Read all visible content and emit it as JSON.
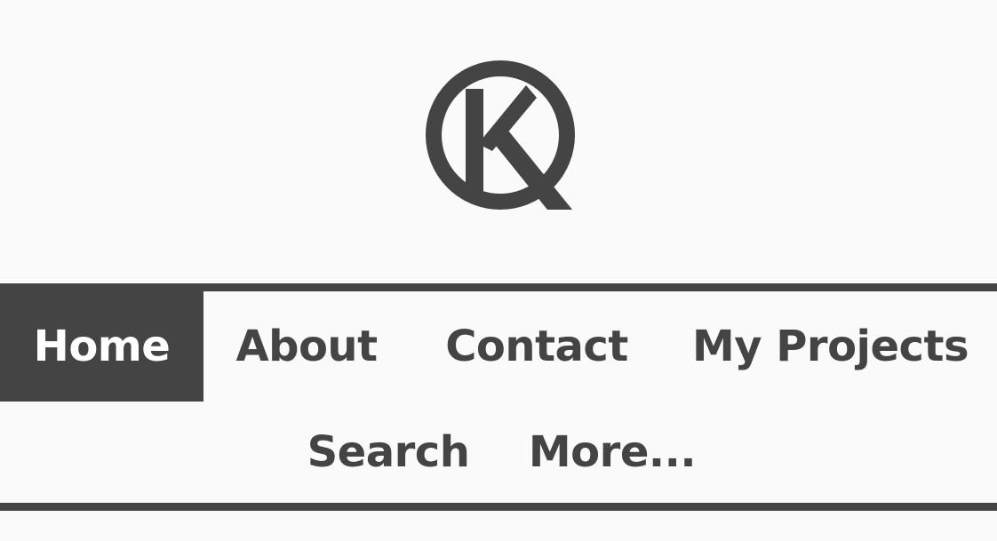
{
  "theme": {
    "background": "#fafafa",
    "accent": "#444444",
    "active_text": "#ffffff"
  },
  "logo": {
    "icon": "k-circle-logo-icon"
  },
  "nav": {
    "items": [
      {
        "label": "Home",
        "active": true
      },
      {
        "label": "About",
        "active": false
      },
      {
        "label": "Contact",
        "active": false
      },
      {
        "label": "My Projects",
        "active": false
      },
      {
        "label": "Search",
        "active": false
      },
      {
        "label": "More...",
        "active": false
      }
    ]
  }
}
